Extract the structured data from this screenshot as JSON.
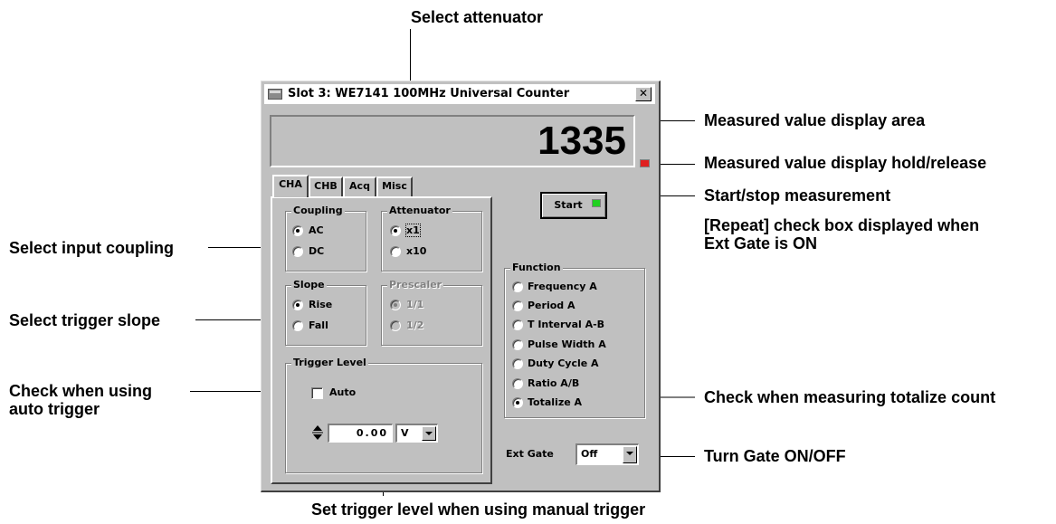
{
  "window": {
    "title": "Slot 3: WE7141 100MHz Universal Counter",
    "close_glyph": "✕"
  },
  "display": {
    "value": "1335"
  },
  "tabs": [
    {
      "label": "CHA",
      "active": true
    },
    {
      "label": "CHB",
      "active": false
    },
    {
      "label": "Acq",
      "active": false
    },
    {
      "label": "Misc",
      "active": false
    }
  ],
  "coupling": {
    "title": "Coupling",
    "options": [
      "AC",
      "DC"
    ],
    "selected": "AC"
  },
  "attenuator": {
    "title": "Attenuator",
    "options": [
      "x1",
      "x10"
    ],
    "selected": "x1"
  },
  "slope": {
    "title": "Slope",
    "options": [
      "Rise",
      "Fall"
    ],
    "selected": "Rise"
  },
  "prescaler": {
    "title": "Prescaler",
    "options": [
      "1/1",
      "1/2"
    ],
    "selected": "1/1",
    "enabled": false
  },
  "trigger_level": {
    "title": "Trigger Level",
    "auto_label": "Auto",
    "auto_checked": false,
    "value": "0.00",
    "unit": "V"
  },
  "start_button": {
    "label": "Start",
    "indicator_color": "#20d020"
  },
  "function": {
    "title": "Function",
    "options": [
      "Frequency A",
      "Period A",
      "T Interval A-B",
      "Pulse Width A",
      "Duty Cycle A",
      "Ratio A/B",
      "Totalize A"
    ],
    "selected": "Totalize A"
  },
  "ext_gate": {
    "label": "Ext Gate",
    "value": "Off"
  },
  "annotations": {
    "select_attenuator": "Select attenuator",
    "measured_value_display_area": "Measured value display area",
    "display_hold_release": "Measured value display hold/release",
    "start_stop": "Start/stop measurement",
    "repeat_checkbox_line1": "[Repeat] check box displayed when",
    "repeat_checkbox_line2": "Ext Gate is ON",
    "select_input_coupling": "Select input coupling",
    "select_trigger_slope": "Select trigger slope",
    "auto_trigger_line1": "Check when using",
    "auto_trigger_line2": "auto trigger",
    "totalize": "Check when measuring totalize count",
    "turn_gate": "Turn Gate ON/OFF",
    "set_trigger_level": "Set trigger level when using manual trigger"
  },
  "colors": {
    "window_bg": "#c0c0c0",
    "hold_indicator": "#e02020",
    "start_indicator": "#20d020"
  }
}
